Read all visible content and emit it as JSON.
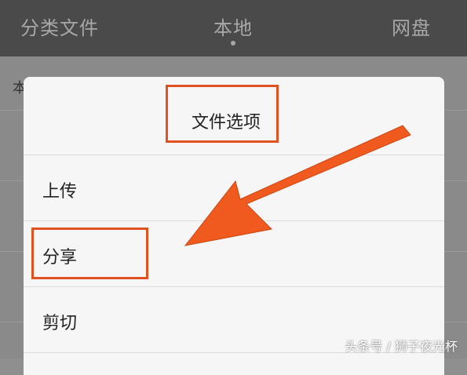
{
  "top_tabs": [
    {
      "label": "分类文件"
    },
    {
      "label": "本地"
    },
    {
      "label": "网盘"
    }
  ],
  "background_row_text": "本",
  "dialog": {
    "title": "文件选项",
    "items": [
      {
        "label": "上传"
      },
      {
        "label": "分享"
      },
      {
        "label": "剪切"
      }
    ]
  },
  "watermark": "头条号 / 狮子夜光杯",
  "colors": {
    "highlight": "#e0521f",
    "arrow": "#f05a1e"
  }
}
